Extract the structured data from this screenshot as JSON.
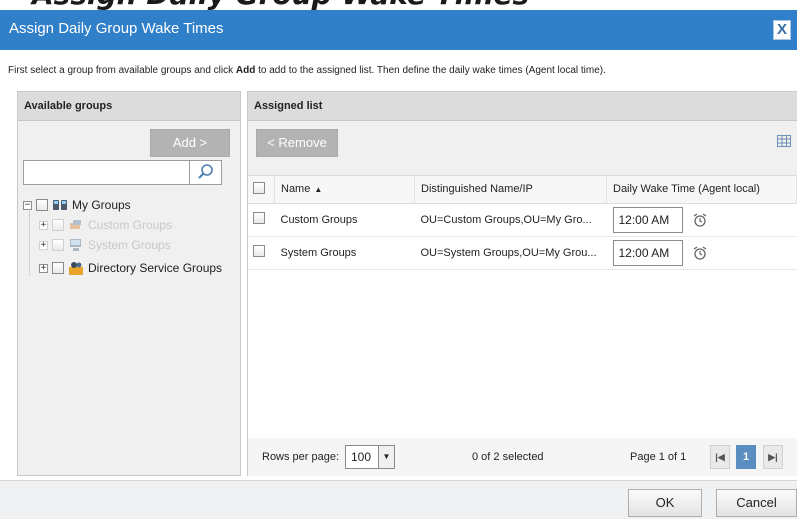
{
  "dialog": {
    "title": "Assign Daily Group Wake Times",
    "close_label": "X",
    "instruction_pre": "First select a group from available groups and click ",
    "instruction_bold": "Add",
    "instruction_post": " to add to the assigned list. Then define the daily wake times (Agent local time)."
  },
  "background_title": "Assign Daily Group Wake Times",
  "left_panel": {
    "header": "Available groups",
    "add_label": "Add >",
    "search_value": "",
    "search_icon": "search-icon",
    "tree": [
      {
        "label": "My Groups",
        "icon": "my-groups-icon",
        "expander": "−",
        "enabled": true
      },
      {
        "label": "Custom Groups",
        "icon": "custom-groups-icon",
        "expander": "+",
        "enabled": false
      },
      {
        "label": "System Groups",
        "icon": "system-groups-icon",
        "expander": "+",
        "enabled": false
      },
      {
        "label": "Directory Service Groups",
        "icon": "directory-groups-icon",
        "expander": "+",
        "enabled": true
      }
    ]
  },
  "right_panel": {
    "header": "Assigned list",
    "remove_label": "< Remove",
    "columns": {
      "name": "Name",
      "dn": "Distinguished Name/IP",
      "wake": "Daily Wake Time (Agent local)"
    },
    "rows": [
      {
        "name": "Custom Groups",
        "dn": "OU=Custom Groups,OU=My Gro...",
        "time": "12:00 AM"
      },
      {
        "name": "System Groups",
        "dn": "OU=System Groups,OU=My Grou...",
        "time": "12:00 AM"
      }
    ],
    "pager": {
      "rows_label": "Rows per page:",
      "rows_value": "100",
      "selected": "0 of 2 selected",
      "page_label": "Page 1 of 1",
      "current_page": "1",
      "first_glyph": "|◀",
      "next_glyph": "▶|"
    }
  },
  "footer": {
    "ok_label": "OK",
    "cancel_label": "Cancel"
  },
  "colors": {
    "titlebar": "#2f7fc9",
    "active_page": "#5b8ec0",
    "disabled_text": "#c8c8c8"
  }
}
